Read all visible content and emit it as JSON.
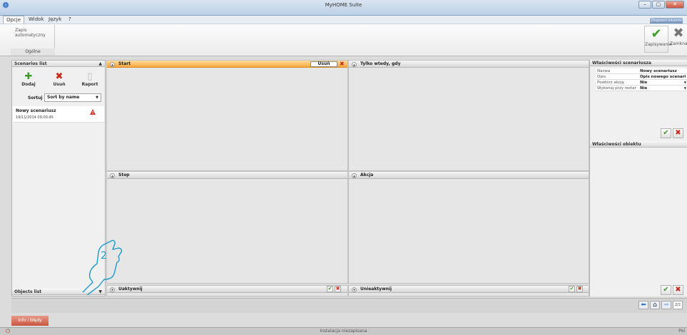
{
  "window": {
    "title": "MyHOME Suite",
    "buttons": [
      "–",
      "▢",
      "✕"
    ]
  },
  "menu": {
    "items": [
      "Opcje",
      "Widok",
      "Język",
      "?"
    ],
    "login": "Zlogowni Intumm"
  },
  "ribbon": {
    "auto_save": "Zapis automatyczny",
    "group_label": "Ogólne",
    "save_label": "Zapisywanie",
    "close_label": "Zamkna"
  },
  "left_panel": {
    "scenarios_title": "Scenarios list",
    "toolbar": {
      "add": "Dodaj",
      "remove": "Usuń",
      "report": "Raport"
    },
    "sort_label": "Sortuj",
    "sort_value": "Sort by name",
    "scenario": {
      "name": "Nowy scenariusz",
      "date": "19/11/2014 09:00:45"
    },
    "objects_title": "Objects list"
  },
  "center": {
    "start": "Start",
    "start_remove": "Usuń",
    "only_when": "Tylko wtedy, gdy",
    "stop": "Stop",
    "action": "Akcja",
    "enabled": "Uaktywnij",
    "disabled": "Unieaktywnij"
  },
  "right_panel": {
    "scenario_props_title": "Właściwości scenariusza",
    "props": [
      {
        "key": "Nazwa",
        "value": "Nowy scenariusz",
        "dropdown": false
      },
      {
        "key": "Opis",
        "value": "Opis nowego scenari",
        "dropdown": false
      },
      {
        "key": "Powtórz akcję",
        "value": "Nie",
        "dropdown": true
      },
      {
        "key": "Wykonaj przy restar",
        "value": "Nie",
        "dropdown": true
      }
    ],
    "object_props_title": "Właściwości obiektu"
  },
  "status": {
    "page_indicator": "2/2"
  },
  "info_tab": "Info i błędy",
  "bottom": {
    "status": "Instalacja niezapisana",
    "right": "Pol"
  },
  "annotation": {
    "number": "2"
  },
  "colors": {
    "start_header": "#f6a53a",
    "ok": "#3f9b2a",
    "cancel": "#c62b1d",
    "info_tab": "#c9553f"
  }
}
